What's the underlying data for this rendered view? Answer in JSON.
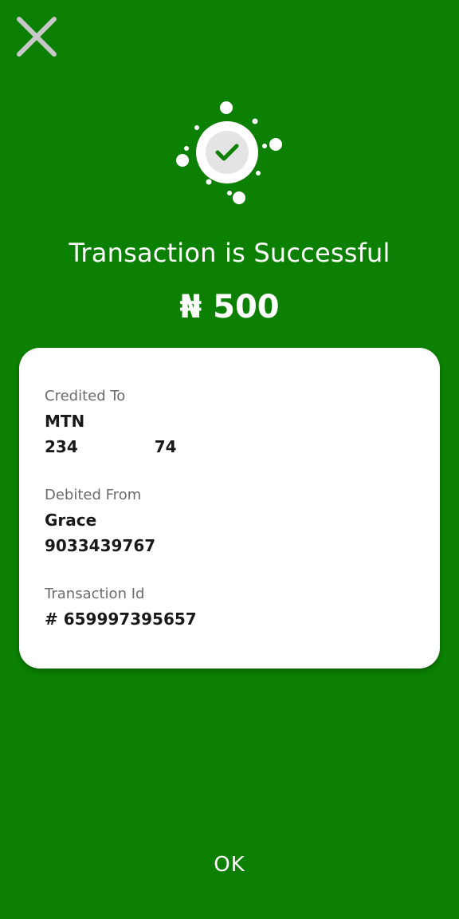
{
  "header": {
    "close_icon": "close-icon"
  },
  "status": {
    "icon": "check-icon",
    "title": "Transaction is Successful",
    "amount": "₦ 500"
  },
  "details": {
    "credited_to": {
      "label": "Credited To",
      "name": "MTN",
      "number": "23474"
    },
    "debited_from": {
      "label": "Debited From",
      "name": "Grace",
      "number": "9033439767"
    },
    "transaction": {
      "label": "Transaction Id",
      "id": "# 659997395657"
    }
  },
  "footer": {
    "ok_label": "OK"
  },
  "colors": {
    "background": "#0b8002",
    "card": "#ffffff",
    "check": "#0b8002"
  }
}
